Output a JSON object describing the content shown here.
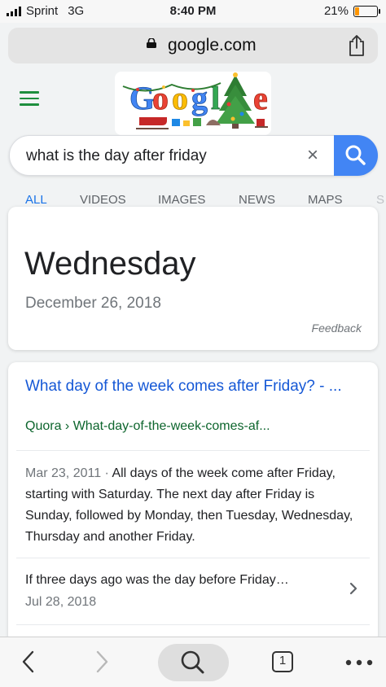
{
  "status": {
    "carrier": "Sprint",
    "network": "3G",
    "time": "8:40 PM",
    "battery_text": "21%",
    "battery_level": 0.21,
    "battery_color": "#ff9500"
  },
  "browser": {
    "domain": "google.com",
    "lock_icon": "lock-icon",
    "share_icon": "share-icon"
  },
  "header": {
    "menu_icon": "hamburger-menu-icon",
    "doodle_text": "Google"
  },
  "search": {
    "query": "what is the day after friday",
    "clear_icon": "×",
    "submit_icon": "search-icon"
  },
  "tabs": [
    {
      "label": "ALL",
      "active": true
    },
    {
      "label": "VIDEOS"
    },
    {
      "label": "IMAGES"
    },
    {
      "label": "NEWS"
    },
    {
      "label": "MAPS"
    },
    {
      "label": "S"
    }
  ],
  "answer_card": {
    "answer": "Wednesday",
    "date": "December 26, 2018",
    "feedback": "Feedback"
  },
  "result": {
    "title": "What day of the week comes after Friday? - ...",
    "breadcrumb": "Quora › What-day-of-the-week-comes-af...",
    "snippet_date": "Mar 23, 2011 · ",
    "snippet": "All days of the week come after Friday, starting with Saturday. The next day after Friday is Sunday, followed by Monday, then Tuesday, Wednesday, Thursday and another Friday."
  },
  "related": {
    "question": "If three days ago was the day before Friday…",
    "date": "Jul 28, 2018"
  },
  "toolbar": {
    "tab_count": "1"
  },
  "colors": {
    "accent": "#1a73e8",
    "link": "#1558d6",
    "url_green": "#0d652d",
    "search_button": "#4285f4"
  }
}
